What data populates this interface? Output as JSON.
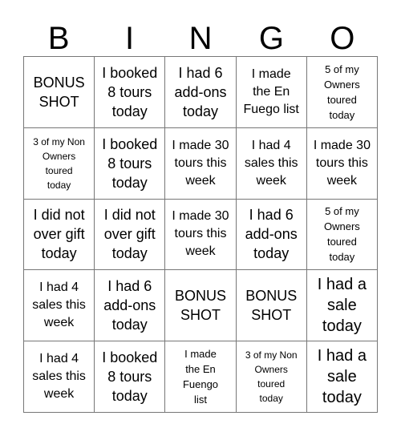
{
  "card": {
    "title": "BINGO",
    "header_letters": [
      "B",
      "I",
      "N",
      "G",
      "O"
    ],
    "grid": {
      "rows": 5,
      "columns": 5,
      "border_color": "#777777",
      "background_color": "#ffffff",
      "text_color": "#000000"
    },
    "cells": [
      {
        "id": "cell-r1c1",
        "text": "BONUS\nSHOT",
        "size": "sz-md"
      },
      {
        "id": "cell-r1c2",
        "text": "I booked\n8 tours\ntoday",
        "size": "sz-md"
      },
      {
        "id": "cell-r1c3",
        "text": "I had 6\nadd-ons\ntoday",
        "size": "sz-md"
      },
      {
        "id": "cell-r1c4",
        "text": "I made\nthe En\nFuego list",
        "size": "sz-sm"
      },
      {
        "id": "cell-r1c5",
        "text": "5 of my\nOwners\ntoured\ntoday",
        "size": "sz-xs"
      },
      {
        "id": "cell-r2c1",
        "text": "3 of my Non\nOwners\ntoured\ntoday",
        "size": "sz-xxs"
      },
      {
        "id": "cell-r2c2",
        "text": "I booked\n8 tours\ntoday",
        "size": "sz-md"
      },
      {
        "id": "cell-r2c3",
        "text": "I made 30\ntours this\nweek",
        "size": "sz-sm"
      },
      {
        "id": "cell-r2c4",
        "text": "I had 4\nsales this\nweek",
        "size": "sz-sm"
      },
      {
        "id": "cell-r2c5",
        "text": "I made 30\ntours this\nweek",
        "size": "sz-sm"
      },
      {
        "id": "cell-r3c1",
        "text": "I did not\nover gift\ntoday",
        "size": "sz-md"
      },
      {
        "id": "cell-r3c2",
        "text": "I did not\nover gift\ntoday",
        "size": "sz-md"
      },
      {
        "id": "cell-r3c3",
        "text": "I made 30\ntours this\nweek",
        "size": "sz-sm"
      },
      {
        "id": "cell-r3c4",
        "text": "I had 6\nadd-ons\ntoday",
        "size": "sz-md"
      },
      {
        "id": "cell-r3c5",
        "text": "5 of my\nOwners\ntoured\ntoday",
        "size": "sz-xs"
      },
      {
        "id": "cell-r4c1",
        "text": "I had 4\nsales this\nweek",
        "size": "sz-sm"
      },
      {
        "id": "cell-r4c2",
        "text": "I had 6\nadd-ons\ntoday",
        "size": "sz-md"
      },
      {
        "id": "cell-r4c3",
        "text": "BONUS\nSHOT",
        "size": "sz-md"
      },
      {
        "id": "cell-r4c4",
        "text": "BONUS\nSHOT",
        "size": "sz-md"
      },
      {
        "id": "cell-r4c5",
        "text": "I had a\nsale\ntoday",
        "size": "sz-lg"
      },
      {
        "id": "cell-r5c1",
        "text": "I had 4\nsales this\nweek",
        "size": "sz-sm"
      },
      {
        "id": "cell-r5c2",
        "text": "I booked\n8 tours\ntoday",
        "size": "sz-md"
      },
      {
        "id": "cell-r5c3",
        "text": "I made\nthe En\nFuengo\nlist",
        "size": "sz-xs"
      },
      {
        "id": "cell-r5c4",
        "text": "3 of my Non\nOwners\ntoured\ntoday",
        "size": "sz-xxs"
      },
      {
        "id": "cell-r5c5",
        "text": "I had a\nsale\ntoday",
        "size": "sz-lg"
      }
    ]
  }
}
